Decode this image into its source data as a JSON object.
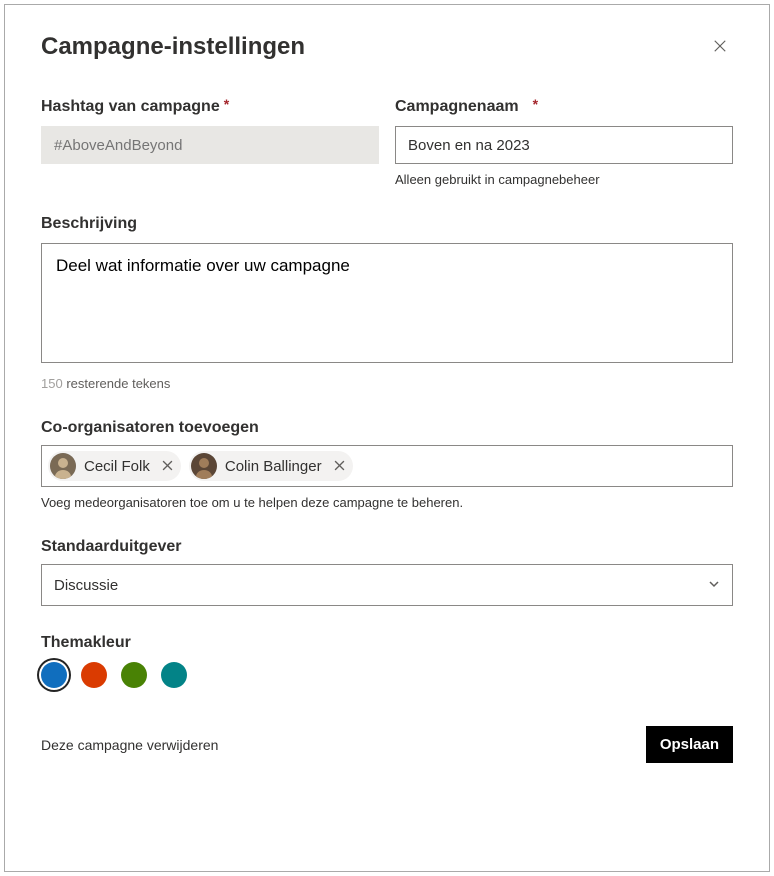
{
  "dialog": {
    "title": "Campagne-instellingen"
  },
  "hashtag": {
    "label": "Hashtag van campagne",
    "placeholder": "#AboveAndBeyond"
  },
  "name": {
    "label": "Campagnenaam",
    "value": "Boven en na 2023",
    "hint": "Alleen gebruikt in campagnebeheer"
  },
  "description": {
    "label": "Beschrijving",
    "value": "Deel wat informatie over uw campagne",
    "chars": "150",
    "chars_suffix": " resterende tekens"
  },
  "coOrganizers": {
    "label": "Co-organisatoren toevoegen",
    "help": "Voeg medeorganisatoren toe om u te helpen deze campagne te beheren.",
    "people": [
      {
        "name": "Cecil  Folk"
      },
      {
        "name": "Colin Ballinger"
      }
    ]
  },
  "publisher": {
    "label": "Standaarduitgever",
    "value": "Discussie"
  },
  "theme": {
    "label": "Themakleur",
    "colors": [
      "#106ebe",
      "#da3b01",
      "#498205",
      "#038387"
    ],
    "selectedIndex": 0
  },
  "footer": {
    "delete": "Deze campagne verwijderen",
    "save": "Opslaan"
  }
}
